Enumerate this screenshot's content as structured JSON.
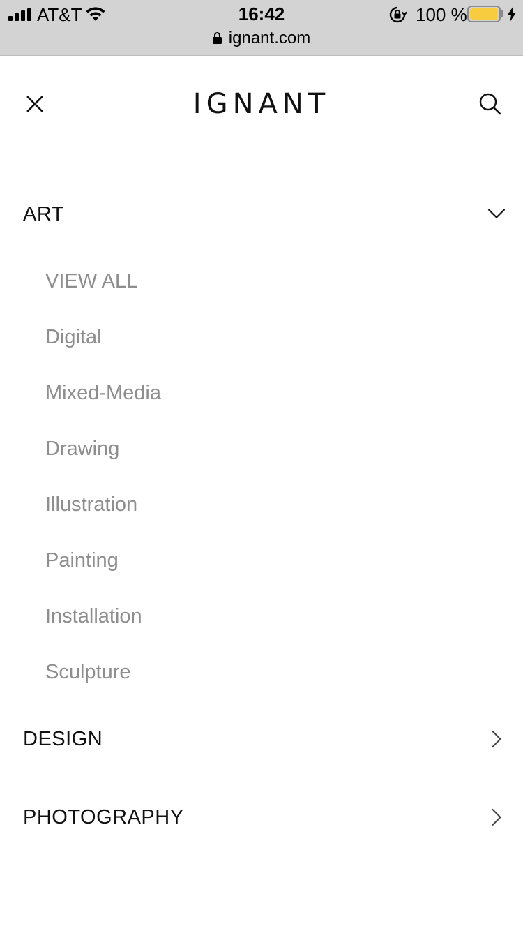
{
  "status_bar": {
    "carrier": "AT&T",
    "time": "16:42",
    "battery_percent": "100 %",
    "battery_level": 1.0,
    "battery_color": "#f7cd3f",
    "icons": [
      "signal-icon",
      "wifi-icon",
      "rotation-lock-icon",
      "battery-icon",
      "charging-icon"
    ]
  },
  "browser": {
    "url": "ignant.com",
    "secure_icon": "lock-icon"
  },
  "header": {
    "logo": "IGNANT",
    "close_icon": "close-icon",
    "search_icon": "search-icon"
  },
  "menu": {
    "sections": [
      {
        "label": "ART",
        "expanded": true,
        "icon": "chevron-down-icon",
        "items": [
          {
            "label": "VIEW ALL"
          },
          {
            "label": "Digital"
          },
          {
            "label": "Mixed-Media"
          },
          {
            "label": "Drawing"
          },
          {
            "label": "Illustration"
          },
          {
            "label": "Painting"
          },
          {
            "label": "Installation"
          },
          {
            "label": "Sculpture"
          }
        ]
      },
      {
        "label": "DESIGN",
        "expanded": false,
        "icon": "chevron-right-icon"
      },
      {
        "label": "PHOTOGRAPHY",
        "expanded": false,
        "icon": "chevron-right-icon"
      }
    ],
    "colors": {
      "section_text": "#111111",
      "subitem_text": "#8e8e8e"
    }
  }
}
